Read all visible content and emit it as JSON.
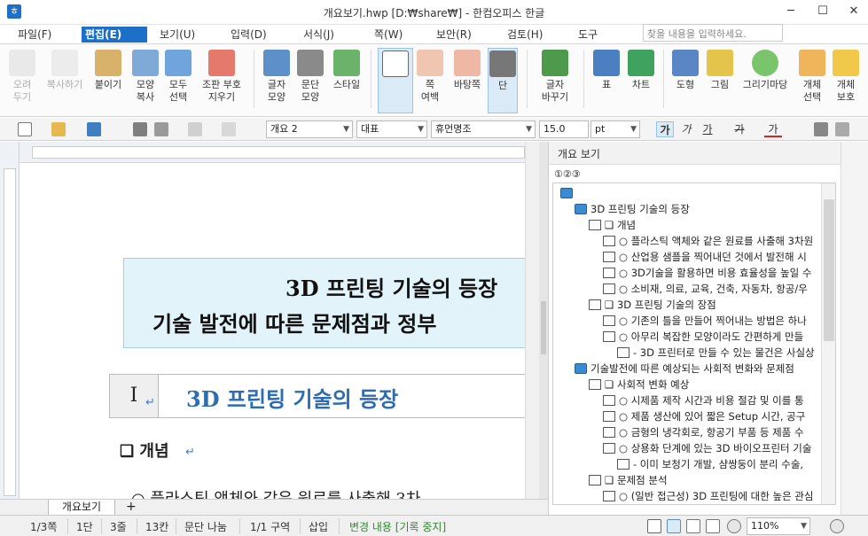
{
  "window": {
    "title": "개요보기.hwp [D:₩share₩] - 한컴오피스 한글",
    "app_icon": "ㅎ",
    "min": "─",
    "max": "☐",
    "close": "✕"
  },
  "menu": {
    "items": [
      "파일(F)",
      "편집(E)",
      "보기(U)",
      "입력(D)",
      "서식(J)",
      "쪽(W)",
      "보안(R)",
      "검토(H)",
      "도구"
    ],
    "active": "편집(E)",
    "search_placeholder": "찾을 내용을 입력하세요."
  },
  "ribbon": {
    "cut": "오려\n두기",
    "copy": "복사하기",
    "paste": "붙이기",
    "format_copy": "모양\n복사",
    "select_all": "모두\n선택",
    "clear_codes": "조판 부호\n지우기",
    "char_shape": "글자\n모양",
    "para_shape": "문단\n모양",
    "style": "스타일",
    "page_margin": "쪽\n여백",
    "background": "바탕쪽",
    "columns": "단",
    "char_change": "글자\n바꾸기",
    "table": "표",
    "chart": "차트",
    "shape": "도형",
    "picture": "그림",
    "grimadang": "그리기마당",
    "object_select": "개체\n선택",
    "object_protect": "개체\n보호"
  },
  "toolbar": {
    "style_combo": "개요 2",
    "font_lang": "대표",
    "font_name": "휴먼명조",
    "font_size": "15.0",
    "font_unit": "pt",
    "bold": "가",
    "italic": "가",
    "underline": "가",
    "strike": "가",
    "color": "가"
  },
  "document": {
    "title_line1": "3D 프린팅 기술의 등장",
    "title_line2": "기술 발전에 따른 문제점과 정부",
    "section_num": "I",
    "section_title": "3D 프린팅 기술의 등장",
    "sub_heading": "❑ 개념",
    "body_line": "○ 플라스틱 액체와 같은 원료를 사출해 3차",
    "para_mark": "↵"
  },
  "tabs": {
    "doc_tab": "개요보기",
    "add_tab": "+"
  },
  "panel": {
    "title": "개요 보기",
    "level_selector": "①②③",
    "rows": [
      {
        "indent": 0,
        "icon": "book",
        "text": ""
      },
      {
        "indent": 1,
        "icon": "book",
        "text": "3D 프린팅 기술의 등장"
      },
      {
        "indent": 2,
        "icon": "page",
        "text": "❑ 개념"
      },
      {
        "indent": 3,
        "icon": "page",
        "text": "○ 플라스틱 액체와 같은 원료를 사출해 3차원"
      },
      {
        "indent": 3,
        "icon": "page",
        "text": "○ 산업용 샘플을 찍어내던 것에서 발전해 시"
      },
      {
        "indent": 3,
        "icon": "page",
        "text": "○ 3D기술을 활용하면 비용 효율성을 높일 수"
      },
      {
        "indent": 3,
        "icon": "page",
        "text": "○ 소비재, 의료, 교육, 건축, 자동차, 항공/우"
      },
      {
        "indent": 2,
        "icon": "page",
        "text": "❑ 3D 프린팅 기술의 장점"
      },
      {
        "indent": 3,
        "icon": "page",
        "text": "○ 기존의 틀을 만들어 찍어내는 방법은 하나"
      },
      {
        "indent": 3,
        "icon": "page",
        "text": "○ 아무리 복잡한 모양이라도 간편하게 만들"
      },
      {
        "indent": 4,
        "icon": "page",
        "text": "- 3D 프린터로 만들 수 있는 물건은 사실상"
      },
      {
        "indent": 1,
        "icon": "book",
        "text": "기술발전에 따른 예상되는 사회적 변화와 문제점"
      },
      {
        "indent": 2,
        "icon": "page",
        "text": "❑ 사회적 변화 예상"
      },
      {
        "indent": 3,
        "icon": "page",
        "text": "○ 시제품 제작 시간과 비용 절감 및 이를 통"
      },
      {
        "indent": 3,
        "icon": "page",
        "text": "○ 제품 생산에 있어 짧은 Setup 시간, 공구"
      },
      {
        "indent": 3,
        "icon": "page",
        "text": "○ 금형의 냉각회로, 항공기 부품 등 제품 수"
      },
      {
        "indent": 3,
        "icon": "page",
        "text": "○ 상용화 단계에 있는 3D 바이오프린터 기술"
      },
      {
        "indent": 4,
        "icon": "page",
        "text": "- 이미 보청기 개발, 샴쌍둥이 분리 수술,"
      },
      {
        "indent": 2,
        "icon": "page",
        "text": "❑ 문제점 분석"
      },
      {
        "indent": 3,
        "icon": "page",
        "text": "○ (일반 접근성) 3D 프린팅에 대한 높은 관심"
      }
    ]
  },
  "status": {
    "page": "1/3쪽",
    "column": "1단",
    "line": "3줄",
    "char": "13칸",
    "para_split": "문단 나눔",
    "section": "1/1 구역",
    "insert": "삽입",
    "track": "변경 내용 [기록 중지]",
    "zoom": "110%",
    "track_color": "#2e8b2e"
  }
}
